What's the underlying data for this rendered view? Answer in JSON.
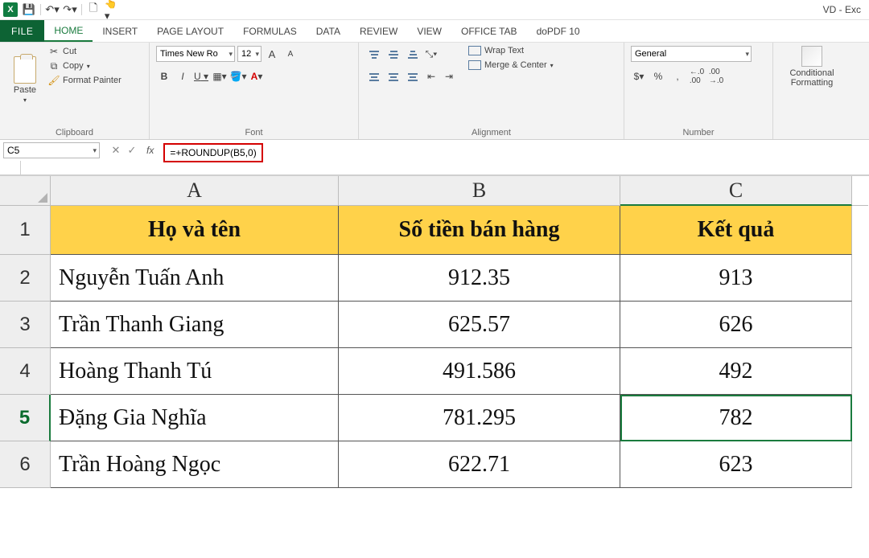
{
  "qat": {
    "app_glyph": "X",
    "icons": [
      "save-icon",
      "undo-icon",
      "redo-icon",
      "print-preview-icon",
      "touch-mode-icon"
    ]
  },
  "window": {
    "title": "VD - Exc"
  },
  "tabs": {
    "file": "FILE",
    "items": [
      "HOME",
      "INSERT",
      "PAGE LAYOUT",
      "FORMULAS",
      "DATA",
      "REVIEW",
      "VIEW",
      "OFFICE TAB",
      "doPDF 10"
    ],
    "active_index": 0
  },
  "ribbon": {
    "clipboard": {
      "paste": "Paste",
      "cut": "Cut",
      "copy": "Copy",
      "format_painter": "Format Painter",
      "label": "Clipboard"
    },
    "font": {
      "name": "Times New Ro",
      "size": "12",
      "increase": "A",
      "decrease": "A",
      "bold": "B",
      "italic": "I",
      "underline": "U",
      "label": "Font"
    },
    "alignment": {
      "wrap": "Wrap Text",
      "merge": "Merge & Center",
      "label": "Alignment"
    },
    "number": {
      "format": "General",
      "currency": "$",
      "percent": "%",
      "comma": ",",
      "inc_dec": ".0",
      "label": "Number"
    },
    "styles": {
      "conditional": "Conditional",
      "formatting": "Formatting"
    }
  },
  "formula_bar": {
    "cell_ref": "C5",
    "cancel": "✕",
    "enter": "✓",
    "fx": "fx",
    "formula": "=+ROUNDUP(B5,0)"
  },
  "columns": [
    "A",
    "B",
    "C"
  ],
  "row_numbers": [
    "1",
    "2",
    "3",
    "4",
    "5",
    "6"
  ],
  "table": {
    "headers": {
      "A": "Họ và tên",
      "B": "Số tiền bán hàng",
      "C": "Kết quả"
    },
    "rows": [
      {
        "A": "Nguyễn Tuấn Anh",
        "B": "912.35",
        "C": "913"
      },
      {
        "A": "Trần Thanh Giang",
        "B": "625.57",
        "C": "626"
      },
      {
        "A": "Hoàng Thanh Tú",
        "B": "491.586",
        "C": "492"
      },
      {
        "A": "Đặng Gia Nghĩa",
        "B": "781.295",
        "C": "782"
      },
      {
        "A": "Trần Hoàng Ngọc",
        "B": "622.71",
        "C": "623"
      }
    ]
  },
  "selected": {
    "row_index": 3,
    "col": "C"
  }
}
